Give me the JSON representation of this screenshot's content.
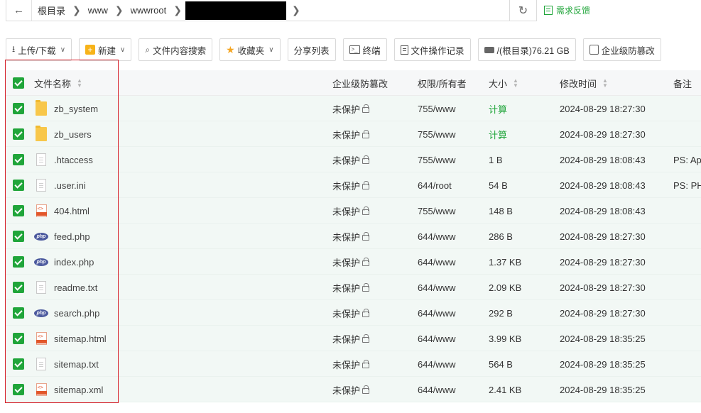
{
  "breadcrumb": {
    "back_icon": "arrow-left-icon",
    "items": [
      "根目录",
      "www",
      "wwwroot"
    ]
  },
  "refresh_icon": "refresh-icon",
  "feedback": {
    "label": "需求反馈",
    "icon": "feedback-icon"
  },
  "toolbar": {
    "upload_download": "上传/下载",
    "new": "新建",
    "content_search": "文件内容搜索",
    "favorites": "收藏夹",
    "share_list": "分享列表",
    "terminal": "终端",
    "op_log": "文件操作记录",
    "disk": "/(根目录)76.21 GB",
    "tamper": "企业级防篡改"
  },
  "table": {
    "headers": {
      "name": "文件名称",
      "protect": "企业级防篡改",
      "perm": "权限/所有者",
      "size": "大小",
      "mtime": "修改时间",
      "note": "备注"
    },
    "rows": [
      {
        "type": "folder",
        "name": "zb_system",
        "protect": "未保护",
        "perm": "755/www",
        "size": "计算",
        "mtime": "2024-08-29 18:27:30",
        "note": ""
      },
      {
        "type": "folder",
        "name": "zb_users",
        "protect": "未保护",
        "perm": "755/www",
        "size": "计算",
        "mtime": "2024-08-29 18:27:30",
        "note": ""
      },
      {
        "type": "doc",
        "name": ".htaccess",
        "protect": "未保护",
        "perm": "755/www",
        "size": "1 B",
        "mtime": "2024-08-29 18:08:43",
        "note": "PS: Apa"
      },
      {
        "type": "doc",
        "name": ".user.ini",
        "protect": "未保护",
        "perm": "644/root",
        "size": "54 B",
        "mtime": "2024-08-29 18:08:43",
        "note": "PS: PH"
      },
      {
        "type": "html",
        "name": "404.html",
        "protect": "未保护",
        "perm": "755/www",
        "size": "148 B",
        "mtime": "2024-08-29 18:08:43",
        "note": ""
      },
      {
        "type": "php",
        "name": "feed.php",
        "protect": "未保护",
        "perm": "644/www",
        "size": "286 B",
        "mtime": "2024-08-29 18:27:30",
        "note": ""
      },
      {
        "type": "php",
        "name": "index.php",
        "protect": "未保护",
        "perm": "644/www",
        "size": "1.37 KB",
        "mtime": "2024-08-29 18:27:30",
        "note": ""
      },
      {
        "type": "doc",
        "name": "readme.txt",
        "protect": "未保护",
        "perm": "644/www",
        "size": "2.09 KB",
        "mtime": "2024-08-29 18:27:30",
        "note": ""
      },
      {
        "type": "php",
        "name": "search.php",
        "protect": "未保护",
        "perm": "644/www",
        "size": "292 B",
        "mtime": "2024-08-29 18:27:30",
        "note": ""
      },
      {
        "type": "html",
        "name": "sitemap.html",
        "protect": "未保护",
        "perm": "644/www",
        "size": "3.99 KB",
        "mtime": "2024-08-29 18:35:25",
        "note": ""
      },
      {
        "type": "doc",
        "name": "sitemap.txt",
        "protect": "未保护",
        "perm": "644/www",
        "size": "564 B",
        "mtime": "2024-08-29 18:35:25",
        "note": ""
      },
      {
        "type": "xml",
        "name": "sitemap.xml",
        "protect": "未保护",
        "perm": "644/www",
        "size": "2.41 KB",
        "mtime": "2024-08-29 18:35:25",
        "note": ""
      }
    ]
  },
  "colors": {
    "accent": "#20a53a",
    "highlight": "#d6202a",
    "folder": "#f8c74a",
    "php": "#4c5a9e"
  }
}
